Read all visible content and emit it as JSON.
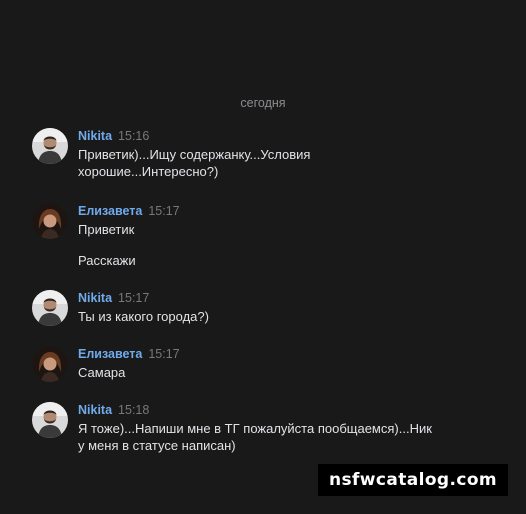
{
  "chat": {
    "date_separator": "сегодня",
    "messages": [
      {
        "author": "Nikita",
        "time": "15:16",
        "avatar": "avatar-nikita",
        "lines": [
          "Приветик)...Ищу содержанку...Условия",
          "хорошие...Интересно?)"
        ]
      },
      {
        "author": "Елизавета",
        "time": "15:17",
        "avatar": "avatar-elizaveta",
        "lines": [
          "Приветик"
        ],
        "extra": "Расскажи"
      },
      {
        "author": "Nikita",
        "time": "15:17",
        "avatar": "avatar-nikita",
        "lines": [
          "Ты из какого города?)"
        ]
      },
      {
        "author": "Елизавета",
        "time": "15:17",
        "avatar": "avatar-elizaveta",
        "lines": [
          "Самара"
        ]
      },
      {
        "author": "Nikita",
        "time": "15:18",
        "avatar": "avatar-nikita",
        "lines": [
          "Я тоже)...Напиши мне в ТГ пожалуйста пообщаемся)...Ник",
          "у меня в статусе написан)"
        ]
      }
    ]
  },
  "watermark": "nsfwcatalog.com",
  "colors": {
    "background": "#19191a",
    "author": "#71aaeb",
    "time": "#76787a",
    "text": "#e1e3e6",
    "date_separator": "#8a8c90"
  }
}
